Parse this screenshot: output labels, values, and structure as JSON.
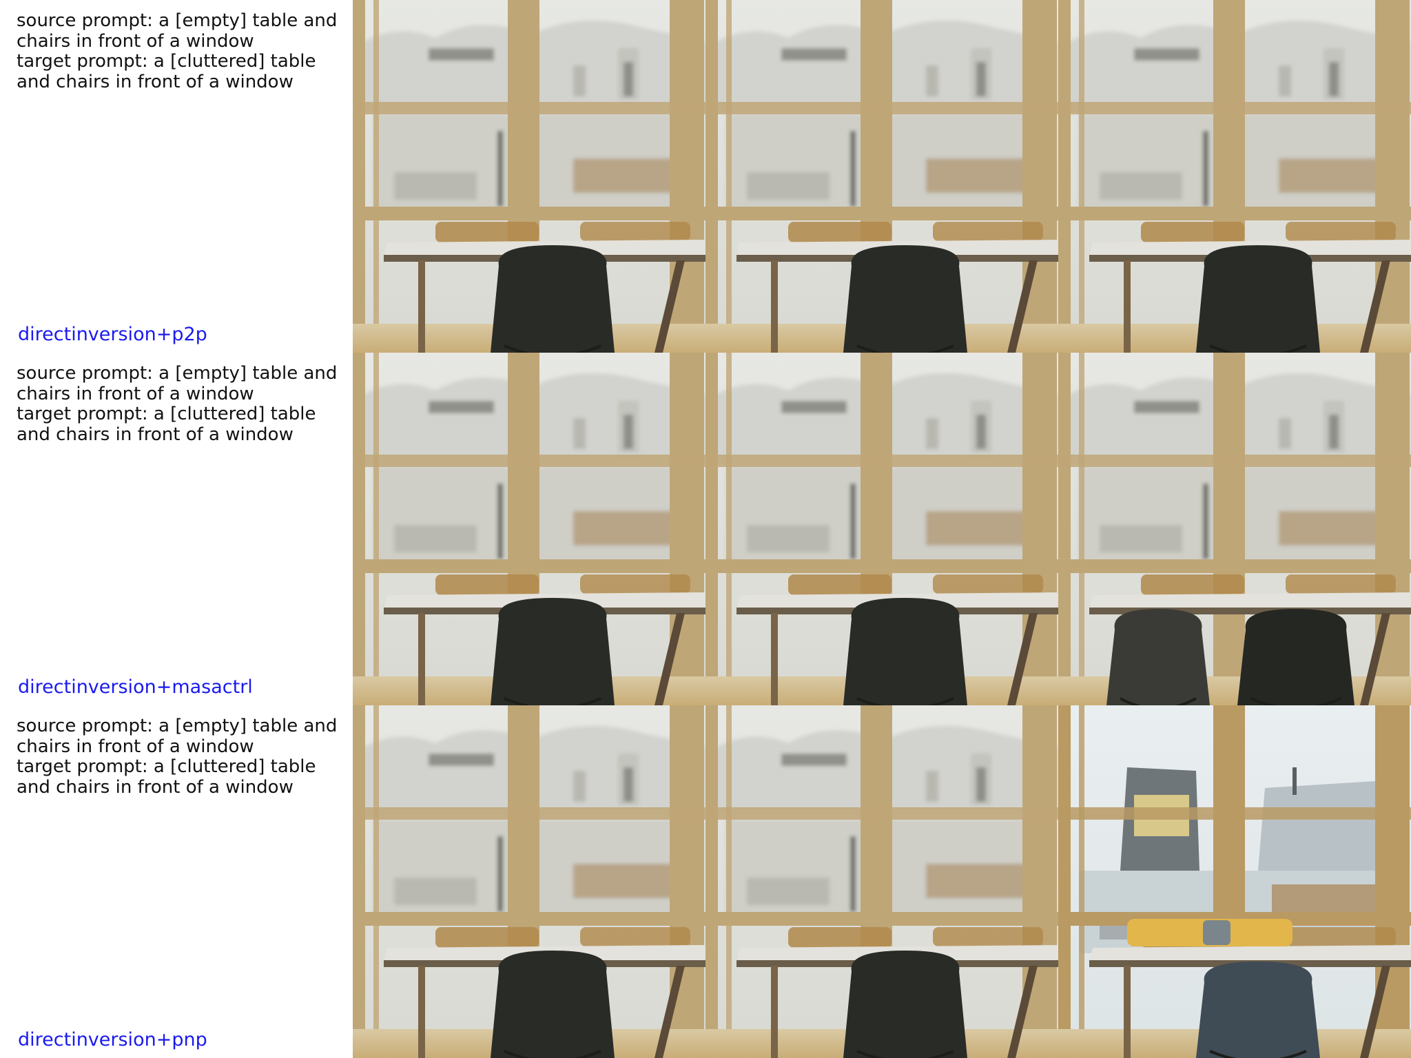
{
  "rows": [
    {
      "source_prompt": "source prompt: a [empty] table and chairs in front of a window",
      "target_prompt": "target prompt: a [cluttered] table and chairs in front of a window",
      "method": "directinversion+p2p",
      "label_color": "#1a1aee",
      "images": [
        {
          "variant": "blurred-room-single-chair"
        },
        {
          "variant": "blurred-room-single-chair"
        },
        {
          "variant": "blurred-room-single-chair"
        }
      ]
    },
    {
      "source_prompt": "source prompt: a [empty] table and chairs in front of a window",
      "target_prompt": "target prompt: a [cluttered] table and chairs in front of a window",
      "method": "directinversion+masactrl",
      "label_color": "#1a1aee",
      "images": [
        {
          "variant": "blurred-room-single-chair"
        },
        {
          "variant": "blurred-room-single-chair"
        },
        {
          "variant": "blurred-room-two-chairs"
        }
      ]
    },
    {
      "source_prompt": "source prompt: a [empty] table and chairs in front of a window",
      "target_prompt": "target prompt: a [cluttered] table and chairs in front of a window",
      "method": "directinversion+pnp",
      "label_color": "#1a1aee",
      "images": [
        {
          "variant": "blurred-room-single-chair"
        },
        {
          "variant": "blurred-room-single-chair"
        },
        {
          "variant": "sharp-room-blue-chair"
        }
      ]
    }
  ]
}
